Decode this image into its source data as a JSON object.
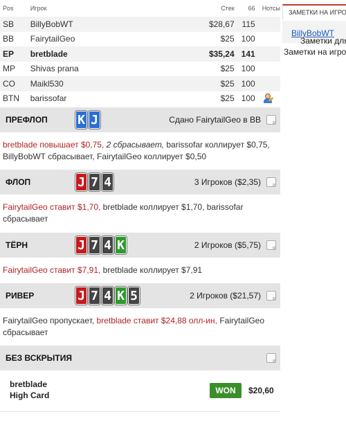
{
  "table": {
    "headers": {
      "pos": "Pos",
      "player": "Игрок",
      "stack": "Стек",
      "bb": "66",
      "notes": "Нотсы"
    },
    "rows": [
      {
        "pos": "SB",
        "name": "BillyBobWT",
        "stack": "$28,67",
        "bb": "115"
      },
      {
        "pos": "BB",
        "name": "FairytailGeo",
        "stack": "$25",
        "bb": "100"
      },
      {
        "pos": "EP",
        "name": "bretblade",
        "stack": "$35,24",
        "bb": "141"
      },
      {
        "pos": "MP",
        "name": "Shivas prana",
        "stack": "$25",
        "bb": "100"
      },
      {
        "pos": "CO",
        "name": "Maikl530",
        "stack": "$25",
        "bb": "100"
      },
      {
        "pos": "BTN",
        "name": "barissofar",
        "stack": "$25",
        "bb": "100"
      }
    ]
  },
  "preflop": {
    "title": "ПРЕФЛОП",
    "cards": [
      "K",
      "J"
    ],
    "info": "Сдано FairytailGeo в BB",
    "actions": {
      "a1": "bretblade повышает $0,75,",
      "a2": "2 сбрасывает,",
      "a3": "barissofar коллирует $0,75,",
      "a4": "BillyBobWT сбрасывает, FairytailGeo коллирует $0,50"
    }
  },
  "flop": {
    "title": "ФЛОП",
    "cards": [
      "J",
      "7",
      "4"
    ],
    "info": "3 Игроков ($2,35)",
    "actions": {
      "a1": "FairytailGeo ставит $1,70,",
      "a2": "bretblade коллирует $1,70, barissofar",
      "a3": "сбрасывает"
    }
  },
  "turn": {
    "title": "ТЁРН",
    "cards": [
      "J",
      "7",
      "4",
      "K"
    ],
    "info": "2 Игроков ($5,75)",
    "actions": {
      "a1": "FairytailGeo ставит $7,91,",
      "a2": "bretblade коллирует $7,91"
    }
  },
  "river": {
    "title": "РИВЕР",
    "cards": [
      "J",
      "7",
      "4",
      "K",
      "5"
    ],
    "info": "2 Игроков ($21,57)",
    "actions": {
      "a1": "FairytailGeo пропускает,",
      "a2": "bretblade ставит $24,88 олл-ин,",
      "a3": "FairytailGeo",
      "a4": "сбрасывает"
    }
  },
  "showdown": {
    "title": "БЕЗ ВСКРЫТИЯ",
    "player": "bretblade",
    "hand": "High Card",
    "result": "WON",
    "amount": "$20,60"
  },
  "right_panel": {
    "tab": "ЗАМЕТКИ НА ИГРОКА",
    "notes_for": "Заметки для",
    "notes_player": "BillyBobWT",
    "notes_label": "Заметки на игрока"
  },
  "colors": {
    "card_blue": "#2a6fd6",
    "card_red": "#c8191d",
    "card_black": "#444444",
    "card_green": "#2e9a2e",
    "won_green": "#3a8f2a",
    "action_red": "#b22222"
  }
}
